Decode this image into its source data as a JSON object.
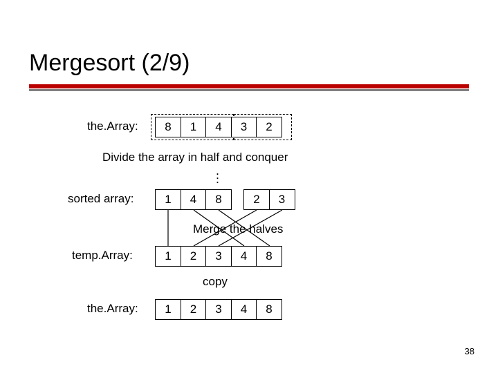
{
  "title": "Mergesort (2/9)",
  "labels": {
    "theArray1": "the.Array:",
    "sortedArray": "sorted array:",
    "tempArray": "temp.Array:",
    "theArray2": "the.Array:"
  },
  "captions": {
    "divide": "Divide the array in half and conquer",
    "merge": "Merge the halves",
    "copy": "copy"
  },
  "arrays": {
    "input": [
      "8",
      "1",
      "4",
      "3",
      "2"
    ],
    "sorted_left": [
      "1",
      "4",
      "8"
    ],
    "sorted_right": [
      "2",
      "3"
    ],
    "temp": [
      "1",
      "2",
      "3",
      "4",
      "8"
    ],
    "final": [
      "1",
      "2",
      "3",
      "4",
      "8"
    ]
  },
  "slide_number": "38"
}
